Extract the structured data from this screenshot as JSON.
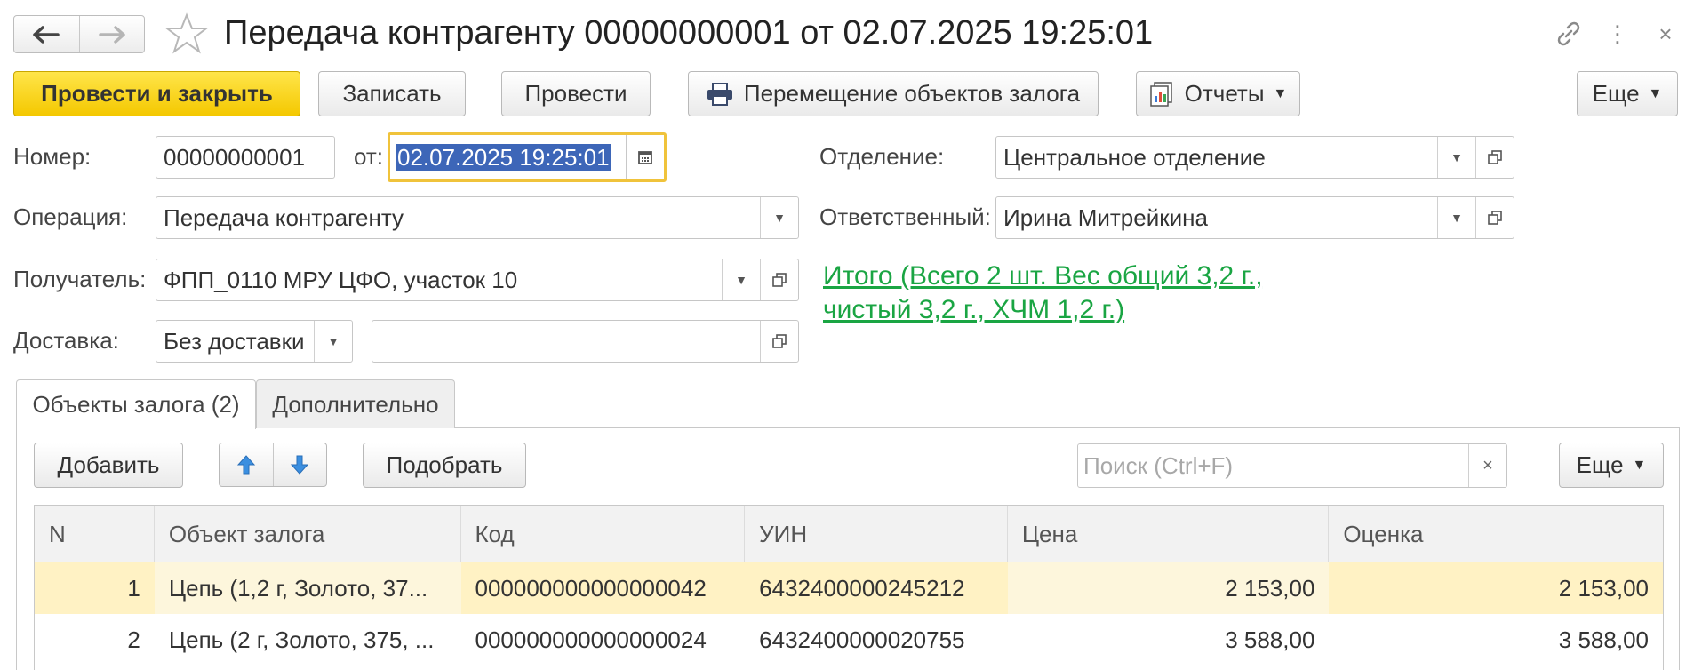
{
  "window": {
    "title": "Передача контрагенту 00000000001 от 02.07.2025 19:25:01",
    "icons": [
      "back-arrow-icon",
      "forward-arrow-icon",
      "star-icon",
      "link-icon",
      "more-vert-icon",
      "close-icon"
    ],
    "more_glyph": "⋮",
    "close_glyph": "×"
  },
  "toolbar": {
    "post_close": "Провести и закрыть",
    "save": "Записать",
    "post": "Провести",
    "move_objects": "Перемещение объектов залога",
    "reports": "Отчеты",
    "more": "Еще"
  },
  "form": {
    "number_label": "Номер:",
    "number_value": "00000000001",
    "date_label": "от:",
    "date_value": "02.07.2025 19:25:01",
    "department_label": "Отделение:",
    "department_value": "Центральное отделение",
    "operation_label": "Операция:",
    "operation_value": "Передача контрагенту",
    "responsible_label": "Ответственный:",
    "responsible_value": "Ирина Митрейкина",
    "recipient_label": "Получатель:",
    "recipient_value": "ФПП_0110 МРУ ЦФО, участок 10",
    "delivery_label": "Доставка:",
    "delivery_value": "Без доставки",
    "delivery_extra_value": "",
    "total_line1": "Итого (Всего 2 шт. Вес общий 3,2 г.,",
    "total_line2": "чистый 3,2 г., ХЧМ 1,2 г.)"
  },
  "tabs": [
    {
      "label": "Объекты залога (2)",
      "active": true
    },
    {
      "label": "Дополнительно",
      "active": false
    }
  ],
  "table_toolbar": {
    "add": "Добавить",
    "pick": "Подобрать",
    "search_placeholder": "Поиск (Ctrl+F)",
    "clear_glyph": "×",
    "more": "Еще"
  },
  "table": {
    "columns": [
      "N",
      "Объект залога",
      "Код",
      "УИН",
      "Цена",
      "Оценка"
    ],
    "rows": [
      {
        "n": "1",
        "object": "Цепь (1,2 г, Золото, 37...",
        "code": "000000000000000042",
        "uin": "6432400000245212",
        "price": "2 153,00",
        "estimate": "2 153,00",
        "selected": true
      },
      {
        "n": "2",
        "object": "Цепь (2 г, Золото, 375, ...",
        "code": "000000000000000024",
        "uin": "6432400000020755",
        "price": "3 588,00",
        "estimate": "3 588,00",
        "selected": false
      }
    ]
  },
  "colors": {
    "primary_button": "#f4c800",
    "link_green": "#1aa543",
    "focus_border": "#f0c33b",
    "selection": "#3d66b8",
    "selected_row": "#fff2c4",
    "arrow_blue": "#3b8fe0"
  }
}
